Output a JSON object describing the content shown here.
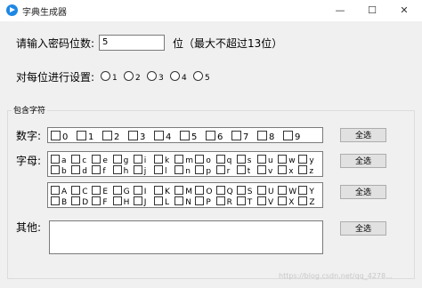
{
  "window": {
    "title": "字典生成器",
    "minimize": "—",
    "maximize": "☐",
    "close": "✕"
  },
  "length": {
    "label": "请输入密码位数:",
    "value": "5",
    "suffix": "位（最大不超过13位）"
  },
  "per_position": {
    "label": "对每位进行设置:",
    "options": [
      "1",
      "2",
      "3",
      "4",
      "5"
    ]
  },
  "charset": {
    "group_title": "包含字符",
    "digits_label": "数字:",
    "digits": [
      "0",
      "1",
      "2",
      "3",
      "4",
      "5",
      "6",
      "7",
      "8",
      "9"
    ],
    "letters_label": "字母:",
    "lowercase_row1": [
      "a",
      "c",
      "e",
      "g",
      "i",
      "k",
      "m",
      "o",
      "q",
      "s",
      "u",
      "w",
      "y"
    ],
    "lowercase_row2": [
      "b",
      "d",
      "f",
      "h",
      "j",
      "l",
      "n",
      "p",
      "r",
      "t",
      "v",
      "x",
      "z"
    ],
    "uppercase_row1": [
      "A",
      "C",
      "E",
      "G",
      "I",
      "K",
      "M",
      "O",
      "Q",
      "S",
      "U",
      "W",
      "Y"
    ],
    "uppercase_row2": [
      "B",
      "D",
      "F",
      "H",
      "J",
      "L",
      "N",
      "P",
      "R",
      "T",
      "V",
      "X",
      "Z"
    ],
    "other_label": "其他:",
    "select_all": "全选"
  },
  "watermark": "https://blog.csdn.net/qq_4278..."
}
